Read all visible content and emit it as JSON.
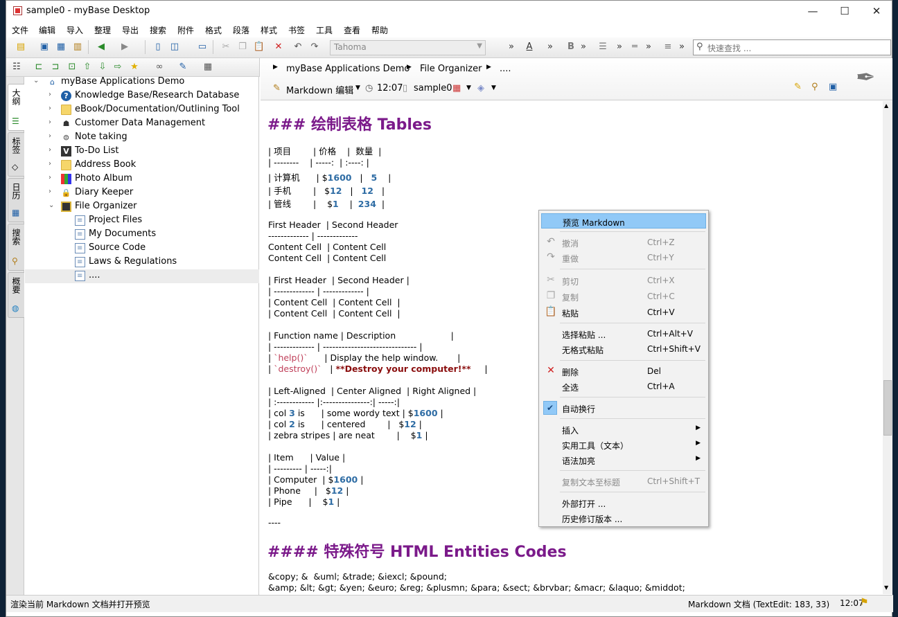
{
  "window": {
    "title": "sample0 - myBase Desktop",
    "min": "—",
    "max": "☐",
    "close": "✕"
  },
  "menu": [
    "文件",
    "编辑",
    "导入",
    "整理",
    "导出",
    "搜索",
    "附件",
    "格式",
    "段落",
    "样式",
    "书签",
    "工具",
    "查看",
    "帮助"
  ],
  "toolbar": {
    "font": "Tahoma",
    "search_placeholder": "快速查找 ..."
  },
  "sidetabs": [
    {
      "label": "大纲",
      "icon": "outline-icon"
    },
    {
      "label": "标签",
      "icon": "tag-icon"
    },
    {
      "label": "日历",
      "icon": "calendar-icon"
    },
    {
      "label": "搜索",
      "icon": "search-icon"
    },
    {
      "label": "概要",
      "icon": "globe-icon"
    }
  ],
  "tree": {
    "root": "myBase Applications Demo",
    "items": [
      {
        "label": "Knowledge Base/Research Database",
        "icon": "help-icon"
      },
      {
        "label": "eBook/Documentation/Outlining Tool",
        "icon": "folder-icon"
      },
      {
        "label": "Customer Data Management",
        "icon": "customer-icon"
      },
      {
        "label": "Note taking",
        "icon": "note-icon"
      },
      {
        "label": "To-Do List",
        "icon": "todo-icon"
      },
      {
        "label": "Address Book",
        "icon": "folder-icon"
      },
      {
        "label": "Photo Album",
        "icon": "photo-icon"
      },
      {
        "label": "Diary Keeper",
        "icon": "lock-icon"
      },
      {
        "label": "File Organizer",
        "icon": "cabinet-icon"
      }
    ],
    "children": [
      "Project Files",
      "My Documents",
      "Source Code",
      "Laws & Regulations",
      "...."
    ]
  },
  "breadcrumb": [
    "myBase Applications Demo",
    "File Organizer",
    "...."
  ],
  "editbar": {
    "mode": "Markdown 编辑",
    "time": "12:07",
    "doc": "sample0"
  },
  "editor": {
    "h3_tables": "### 绘制表格 Tables",
    "h4_entities": "#### 特殊符号 HTML Entities Codes",
    "hr": "----",
    "entities1": "&copy; &  &uml; &trade; &iexcl; &pound;",
    "entities2": "&amp; &lt; &gt; &yen; &euro; &reg; &plusmn; &para; &sect; &brvbar; &macr; &laquo; &middot;"
  },
  "context_menu": {
    "preview": "预览 Markdown",
    "undo": "撤消",
    "undo_k": "Ctrl+Z",
    "redo": "重做",
    "redo_k": "Ctrl+Y",
    "cut": "剪切",
    "cut_k": "Ctrl+X",
    "copy": "复制",
    "copy_k": "Ctrl+C",
    "paste": "粘贴",
    "paste_k": "Ctrl+V",
    "paste_special": "选择粘贴 ...",
    "paste_special_k": "Ctrl+Alt+V",
    "paste_plain": "无格式粘贴",
    "paste_plain_k": "Ctrl+Shift+V",
    "delete": "删除",
    "delete_k": "Del",
    "select_all": "全选",
    "select_all_k": "Ctrl+A",
    "word_wrap": "自动换行",
    "insert": "插入",
    "tools": "实用工具（文本）",
    "syntax": "语法加亮",
    "copy_title": "复制文本至标题",
    "copy_title_k": "Ctrl+Shift+T",
    "open_ext": "外部打开 ...",
    "history": "历史修订版本 ..."
  },
  "status": {
    "left": "渲染当前 Markdown 文档并打开预览",
    "right": "Markdown 文档 (TextEdit: 183, 33)",
    "time": "12:07"
  }
}
